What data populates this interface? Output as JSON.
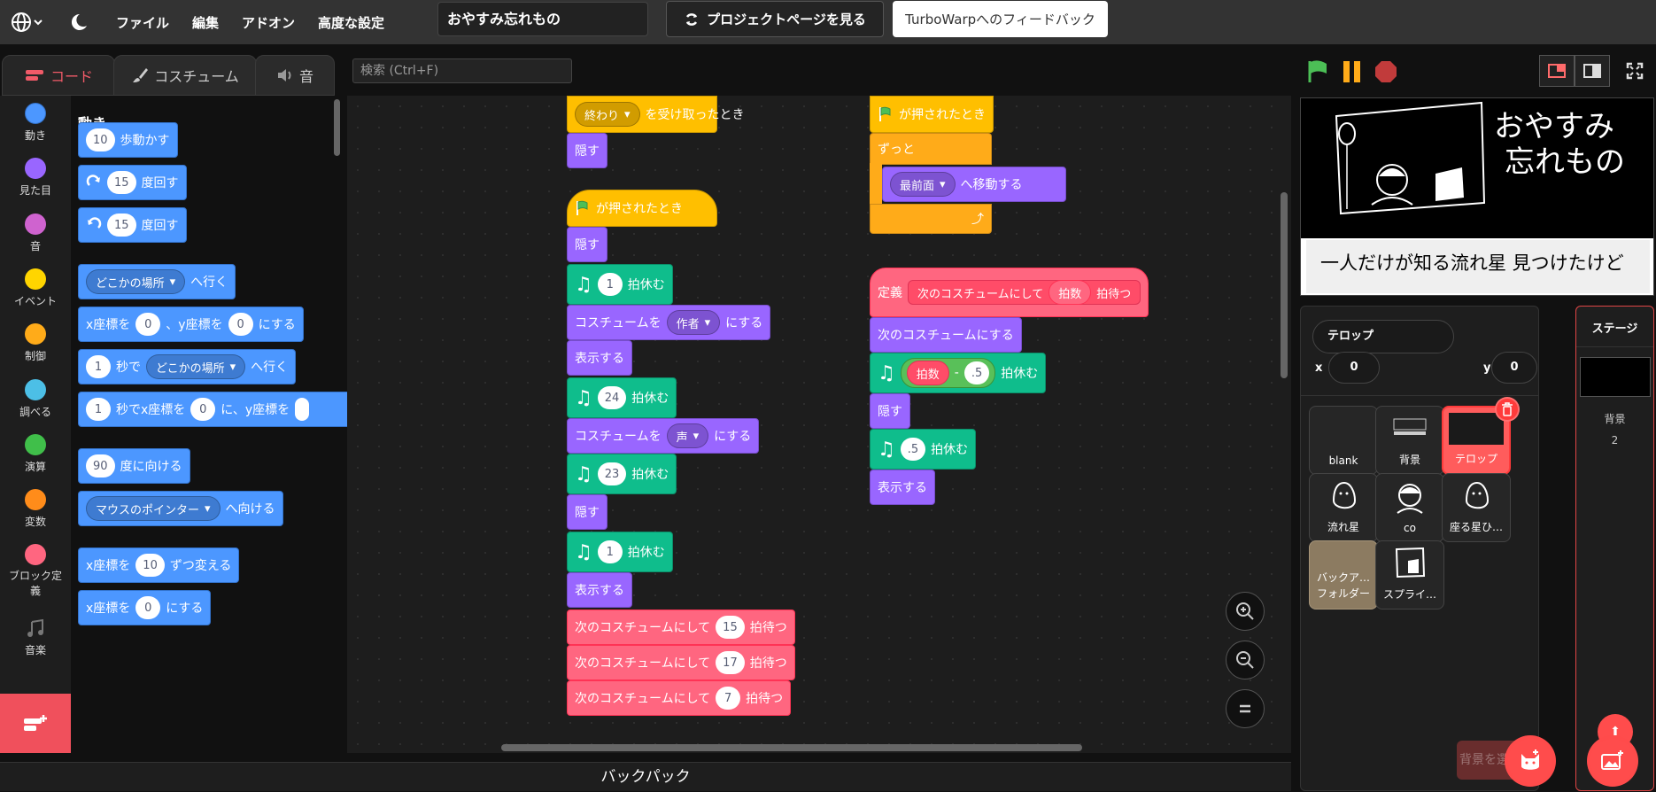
{
  "menu": {
    "file": "ファイル",
    "edit": "編集",
    "addons": "アドオン",
    "advanced": "高度な設定"
  },
  "project_title": "おやすみ忘れもの",
  "see_project": "プロジェクトページを見る",
  "feedback": "TurboWarpへのフィードバック",
  "tabs": {
    "code": "コード",
    "costume": "コスチューム",
    "sound": "音"
  },
  "search_placeholder": "検索 (Ctrl+F)",
  "categories": [
    {
      "label": "動き",
      "color": "#4c97ff"
    },
    {
      "label": "見た目",
      "color": "#9966ff"
    },
    {
      "label": "音",
      "color": "#cf63cf"
    },
    {
      "label": "イベント",
      "color": "#ffd500"
    },
    {
      "label": "制御",
      "color": "#ffab19"
    },
    {
      "label": "調べる",
      "color": "#4cbfe6"
    },
    {
      "label": "演算",
      "color": "#40bf4a"
    },
    {
      "label": "変数",
      "color": "#ff8c1a"
    },
    {
      "label": "ブロック定義",
      "color": "#ff6680"
    },
    {
      "label": "音楽",
      "color": ""
    }
  ],
  "palette": {
    "title": "動き",
    "move": {
      "val": "10",
      "text": "歩動かす"
    },
    "turn_cw": {
      "val": "15",
      "text": "度回す"
    },
    "turn_ccw": {
      "val": "15",
      "text": "度回す"
    },
    "goto": {
      "drop": "どこかの場所",
      "text": "へ行く"
    },
    "gotoxy": {
      "a": "x座標を",
      "x": "0",
      "b": "、y座標を",
      "y": "0",
      "c": "にする"
    },
    "glide": {
      "val": "1",
      "a": "秒で",
      "drop": "どこかの場所",
      "b": "へ行く"
    },
    "glidexy": {
      "val": "1",
      "a": "秒でx座標を",
      "x": "0",
      "b": "に、y座標を"
    },
    "point_dir": {
      "val": "90",
      "text": "度に向ける"
    },
    "point_towards": {
      "drop": "マウスのポインター",
      "text": "へ向ける"
    },
    "change_x": {
      "a": "x座標を",
      "val": "10",
      "b": "ずつ変える"
    },
    "set_x": {
      "a": "x座標を",
      "val": "0",
      "b": "にする"
    }
  },
  "scripts": {
    "s1": {
      "hat_drop": "終わり",
      "hat_text": "を受け取ったとき",
      "hide": "隠す"
    },
    "s2": {
      "hat": "が押されたとき",
      "forever": "ずっと",
      "layer_drop": "最前面",
      "layer_text": "へ移動する"
    },
    "s3": {
      "hat": "が押されたとき",
      "hide1": "隠す",
      "rest1": {
        "val": "1",
        "text": "拍休む"
      },
      "costume1": {
        "a": "コスチュームを",
        "drop": "作者",
        "b": "にする"
      },
      "show1": "表示する",
      "rest2": {
        "val": "24",
        "text": "拍休む"
      },
      "costume2": {
        "a": "コスチュームを",
        "drop": "声",
        "b": "にする"
      },
      "rest3": {
        "val": "23",
        "text": "拍休む"
      },
      "hide2": "隠す",
      "rest4": {
        "val": "1",
        "text": "拍休む"
      },
      "show2": "表示する",
      "call1": {
        "a": "次のコスチュームにして",
        "val": "15",
        "b": "拍待つ"
      },
      "call2": {
        "a": "次のコスチュームにして",
        "val": "17",
        "b": "拍待つ"
      },
      "call3": {
        "a": "次のコスチュームにして",
        "val": "7",
        "b": "拍待つ"
      }
    },
    "s4": {
      "define": "定義",
      "proc": "次のコスチュームにして",
      "param": "拍数",
      "proc_end": "拍待つ",
      "next": "次のコスチュームにする",
      "rest_param": "拍数",
      "minus": "-",
      "rest_val": ".5",
      "rest_text": "拍休む",
      "hide": "隠す",
      "rest2": {
        "val": ".5",
        "text": "拍休む"
      },
      "show": "表示する"
    }
  },
  "backpack": "バックパック",
  "stage_text": {
    "title_line1": "おやすみ",
    "title_line2": "忘れもの",
    "caption": "一人だけが知る流れ星 見つけたけど"
  },
  "sprite_info": {
    "name": "テロップ",
    "x_label": "x",
    "x": "0",
    "y_label": "y",
    "y": "0"
  },
  "sprites": [
    {
      "name": "blank"
    },
    {
      "name": "背景"
    },
    {
      "name": "テロップ"
    },
    {
      "name": "流れ星"
    },
    {
      "name": "co"
    },
    {
      "name": "座る星ひ…"
    },
    {
      "name_line1": "バックア…",
      "name_line2": "フォルダー"
    },
    {
      "name": "スプライ…"
    }
  ],
  "stage_pane": {
    "title": "ステージ",
    "backdrop_label": "背景",
    "backdrop_count": "2"
  },
  "faded_label": "背景を選ぶ",
  "colors": {
    "accent": "#ff4c4c",
    "motion": "#4c97ff",
    "looks": "#9966ff",
    "music": "#0fbd8c",
    "custom": "#ff6680",
    "events": "#ffbf00"
  }
}
